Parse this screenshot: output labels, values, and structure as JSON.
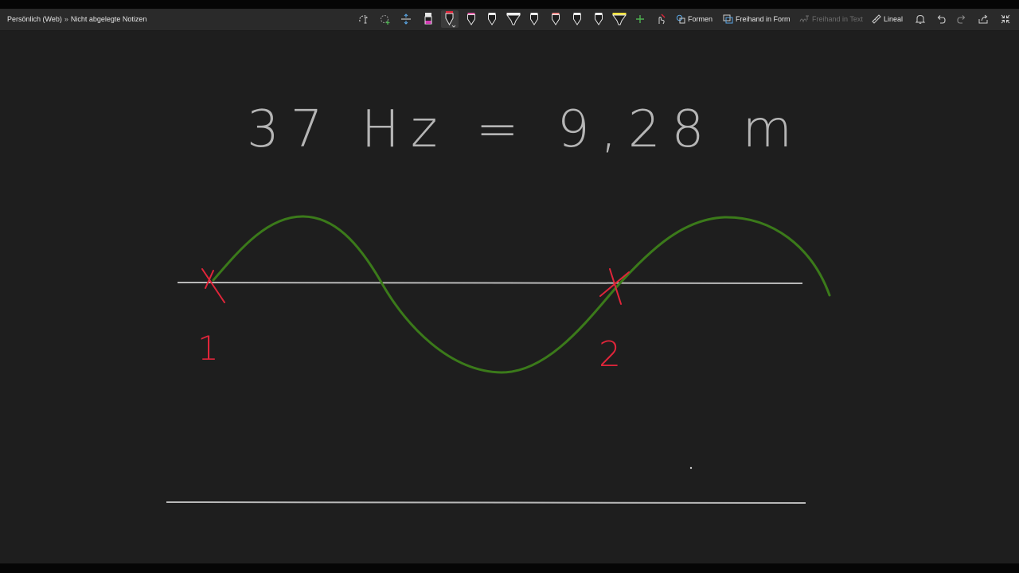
{
  "breadcrumb": {
    "notebook": "Persönlich (Web)",
    "separator": "»",
    "section": "Nicht abgelegte Notizen"
  },
  "toolbar": {
    "buttons": {
      "shapes": "Formen",
      "ink_to_shape": "Freihand in Form",
      "ink_to_text": "Freihand in Text",
      "ruler": "Lineal"
    }
  },
  "ink": {
    "equation_text": "37 Hz = 9,28 m",
    "point_1": "1",
    "point_2": "2",
    "colors": {
      "wave": "#3b7a1a",
      "marker": "#e0253a",
      "line": "#b9b9b9",
      "text": "#b5b5b5"
    }
  }
}
